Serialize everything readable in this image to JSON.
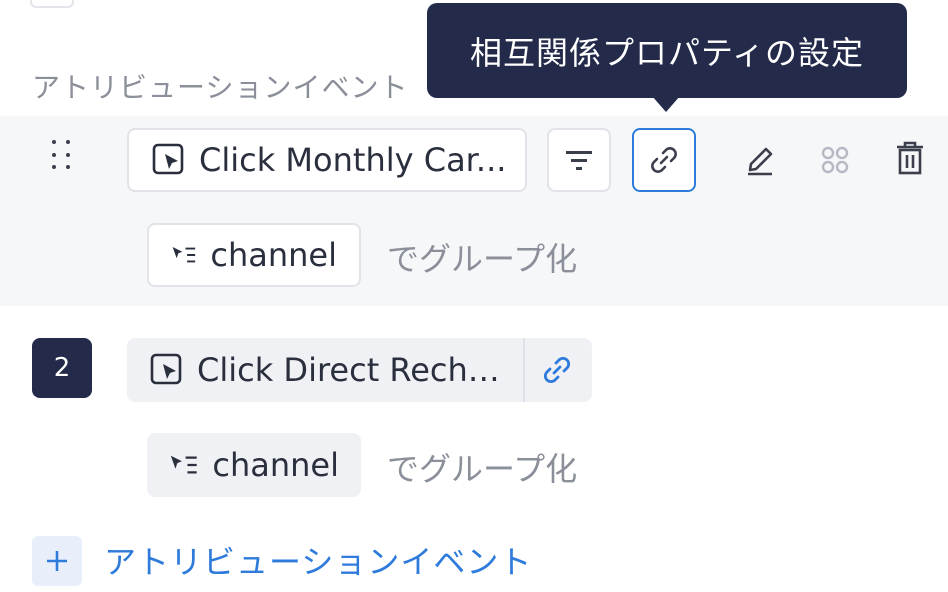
{
  "section": {
    "label": "アトリビューションイベント"
  },
  "tooltip": {
    "text": "相互関係プロパティの設定"
  },
  "events": [
    {
      "index": "",
      "name": "Click Monthly Car...",
      "group_property": "channel",
      "group_suffix": "でグループ化"
    },
    {
      "index": "2",
      "name": "Click Direct Recha...",
      "group_property": "channel",
      "group_suffix": "でグループ化"
    }
  ],
  "add": {
    "label": "アトリビューションイベント"
  },
  "colors": {
    "accent": "#2e7bdc",
    "dark": "#242a4a",
    "muted": "#8a8f99"
  },
  "icons": {
    "event": "cursor-square-icon",
    "group": "group-by-icon",
    "filter": "filter-icon",
    "link": "link-icon",
    "edit": "pencil-icon",
    "group_dots": "four-dots-icon",
    "delete": "trash-icon",
    "drag": "drag-handle-icon",
    "add": "plus-icon"
  }
}
